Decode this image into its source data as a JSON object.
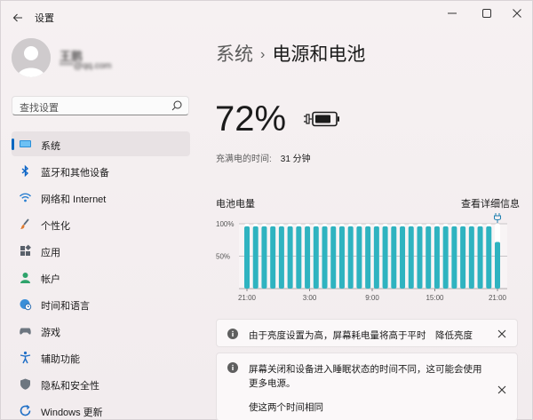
{
  "window": {
    "title": "设置",
    "controls": [
      "minimize",
      "maximize",
      "close"
    ]
  },
  "profile": {
    "name": "王鹏",
    "email": "****@qq.com"
  },
  "search": {
    "placeholder": "查找设置"
  },
  "nav": {
    "items": [
      {
        "label": "系统",
        "icon": "system-display-icon",
        "active": true
      },
      {
        "label": "蓝牙和其他设备",
        "icon": "bluetooth-icon",
        "active": false
      },
      {
        "label": "网络和 Internet",
        "icon": "wifi-icon",
        "active": false
      },
      {
        "label": "个性化",
        "icon": "brush-icon",
        "active": false
      },
      {
        "label": "应用",
        "icon": "apps-icon",
        "active": false
      },
      {
        "label": "帐户",
        "icon": "account-icon",
        "active": false
      },
      {
        "label": "时间和语言",
        "icon": "globe-clock-icon",
        "active": false
      },
      {
        "label": "游戏",
        "icon": "gamepad-icon",
        "active": false
      },
      {
        "label": "辅助功能",
        "icon": "accessibility-icon",
        "active": false
      },
      {
        "label": "隐私和安全性",
        "icon": "shield-icon",
        "active": false
      },
      {
        "label": "Windows 更新",
        "icon": "windows-update-icon",
        "active": false
      }
    ]
  },
  "main": {
    "breadcrumb_parent": "系统",
    "breadcrumb_separator": "›",
    "breadcrumb_current": "电源和电池",
    "battery_percent": "72%",
    "charge_label": "充满电的时间:",
    "charge_value": "31 分钟",
    "chart_title": "电池电量",
    "chart_link": "查看详细信息",
    "notice1": {
      "text": "由于亮度设置为高，屏幕耗电量将高于平时",
      "action": "降低亮度"
    },
    "notice2": {
      "text_line1": "屏幕关闭和设备进入睡眠状态的时间不同，这可能会使用",
      "text_line2": "更多电源。",
      "action": "使这两个时间相同"
    }
  },
  "colors": {
    "accent": "#0067c0",
    "bar": "#2fb3c0",
    "bar_bg": "#ffffff"
  },
  "chart_data": {
    "type": "bar",
    "categories": [
      "21:00",
      "",
      "",
      "",
      "",
      "",
      "3:00",
      "",
      "",
      "",
      "",
      "",
      "9:00",
      "",
      "",
      "",
      "",
      "",
      "15:00",
      "",
      "",
      "",
      "",
      "",
      "21:00"
    ],
    "ytick_labels": [
      "100%",
      "50%"
    ],
    "xtick_labels": [
      "21:00",
      "3:00",
      "9:00",
      "15:00",
      "21:00"
    ],
    "values": [
      96,
      96,
      96,
      96,
      96,
      96,
      96,
      96,
      96,
      96,
      96,
      96,
      96,
      96,
      96,
      96,
      96,
      96,
      96,
      96,
      96,
      96,
      96,
      96,
      96,
      96,
      96,
      96,
      96,
      72
    ],
    "ylim": [
      0,
      100
    ],
    "charging_marker_label": "plug-icon"
  }
}
